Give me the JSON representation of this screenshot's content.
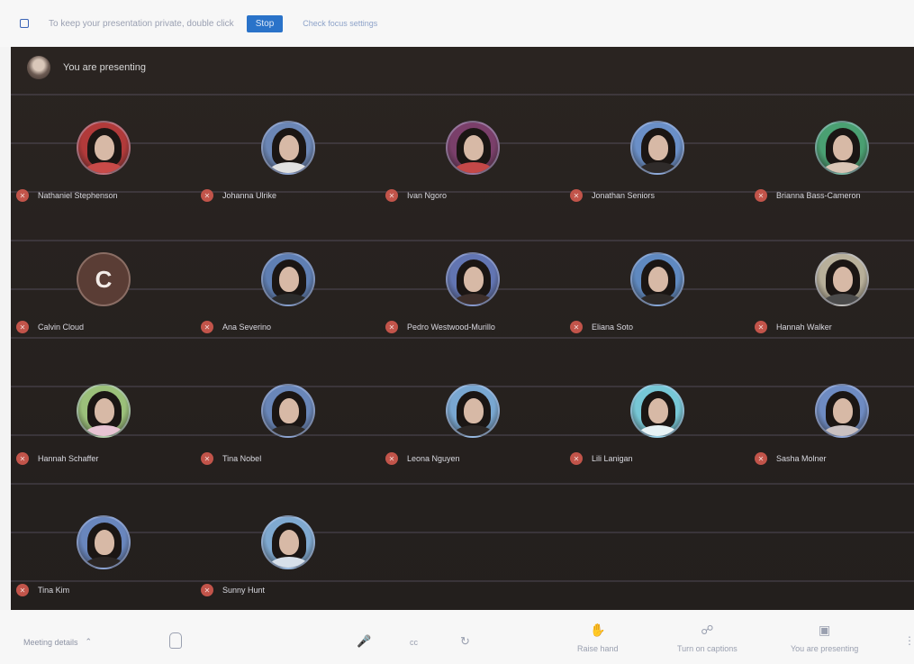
{
  "banner": {
    "message": "To keep your presentation private, double click",
    "action_label": "Stop",
    "link_label": "Check focus settings"
  },
  "stage": {
    "presenting_text": "You are presenting"
  },
  "participants": [
    {
      "name": "Nathaniel Stephenson",
      "avatar": "photo",
      "bg": "#b13a3a",
      "body": "#c84a48"
    },
    {
      "name": "Johanna Ulrike",
      "avatar": "photo",
      "bg": "#6b86b5",
      "body": "#e1e1e1"
    },
    {
      "name": "Ivan Ngoro",
      "avatar": "photo",
      "bg": "#7a3f6a",
      "body": "#c44848"
    },
    {
      "name": "Jonathan Seniors",
      "avatar": "photo",
      "bg": "#6a8fc7",
      "body": "#2f2b2a"
    },
    {
      "name": "Brianna Bass-Cameron",
      "avatar": "photo",
      "bg": "#4aa072",
      "body": "#d9c5b5"
    },
    {
      "name": "Calvin Cloud",
      "avatar": "letter",
      "letter": "C",
      "bg": "#5a3d35"
    },
    {
      "name": "Ana Severino",
      "avatar": "photo",
      "bg": "#5f7fb3",
      "body": "#2b2b2b"
    },
    {
      "name": "Pedro Westwood-Murillo",
      "avatar": "photo",
      "bg": "#6275b2",
      "body": "#3d2f2b"
    },
    {
      "name": "Eliana Soto",
      "avatar": "photo",
      "bg": "#5f89c0",
      "body": "#2e2a28"
    },
    {
      "name": "Hannah Walker",
      "avatar": "photo",
      "bg": "#b8b09a",
      "body": "#4b4b4b"
    },
    {
      "name": "Hannah Schaffer",
      "avatar": "photo",
      "bg": "#9bc07a",
      "body": "#e7c4d3"
    },
    {
      "name": "Tina Nobel",
      "avatar": "photo",
      "bg": "#6986b8",
      "body": "#2f2b29"
    },
    {
      "name": "Leona Nguyen",
      "avatar": "photo",
      "bg": "#79a7d1",
      "body": "#2d2826"
    },
    {
      "name": "Lili Lanigan",
      "avatar": "photo",
      "bg": "#77c7d6",
      "body": "#e7f2f5"
    },
    {
      "name": "Sasha Molner",
      "avatar": "photo",
      "bg": "#6e8bc2",
      "body": "#c9c0c0"
    },
    {
      "name": "Tina Kim",
      "avatar": "photo",
      "bg": "#6986bd",
      "body": "#2b2624"
    },
    {
      "name": "Sunny Hunt",
      "avatar": "photo",
      "bg": "#7fa9d0",
      "body": "#d7e0ea"
    }
  ],
  "controls": {
    "meeting_details": "Meeting details",
    "cc": "cc",
    "raise_hand": "Raise hand",
    "turn_on_captions": "Turn on captions",
    "you_are_presenting": "You are presenting"
  }
}
